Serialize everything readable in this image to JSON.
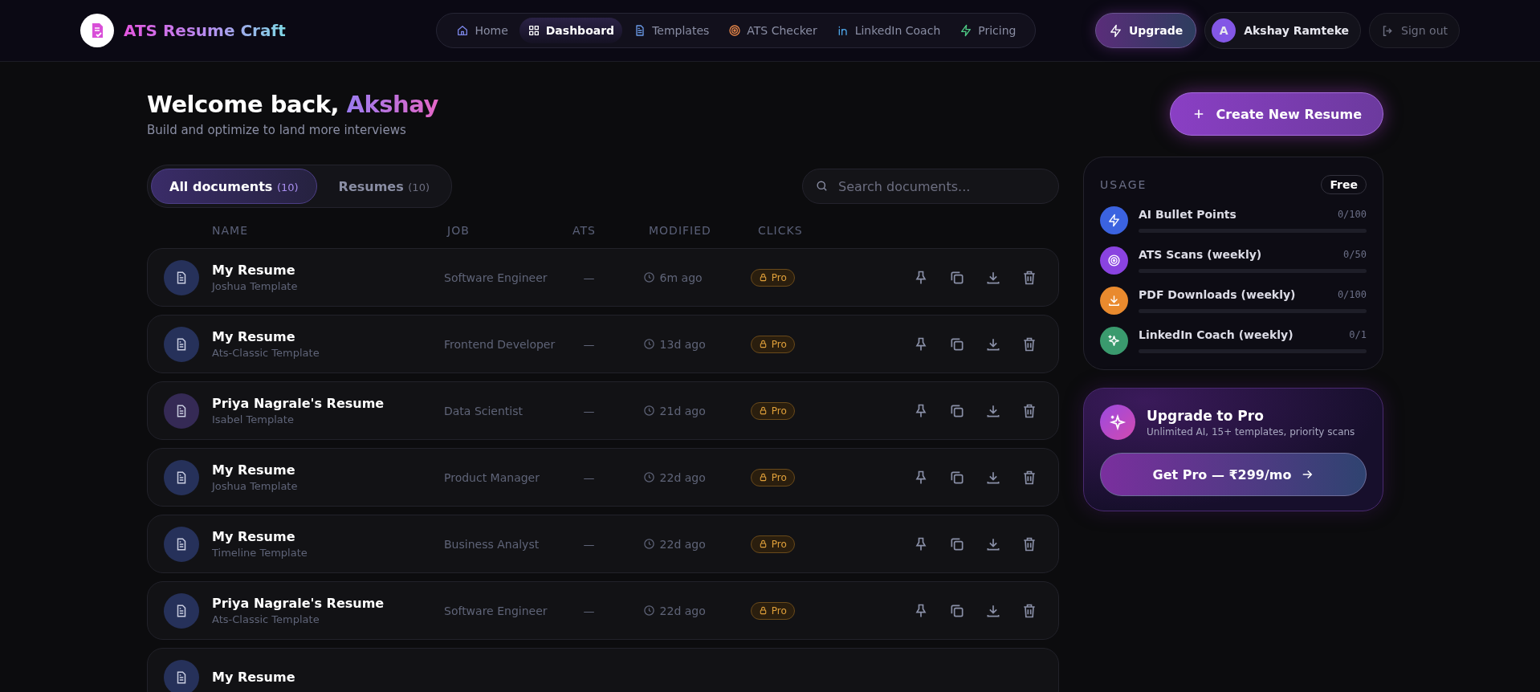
{
  "brand": {
    "name": "ATS Resume Craft"
  },
  "nav": [
    {
      "label": "Home",
      "kind": "home",
      "selected": false
    },
    {
      "label": "Dashboard",
      "kind": "grid",
      "selected": true
    },
    {
      "label": "Templates",
      "kind": "doc",
      "selected": false
    },
    {
      "label": "ATS Checker",
      "kind": "target",
      "selected": false
    },
    {
      "label": "LinkedIn Coach",
      "kind": "linkedin",
      "selected": false
    },
    {
      "label": "Pricing",
      "kind": "bolt",
      "selected": false
    }
  ],
  "header_actions": {
    "upgrade": "Upgrade",
    "user": {
      "initial": "A",
      "name": "Akshay Ramteke"
    },
    "signout": "Sign out"
  },
  "welcome": {
    "greeting": "Welcome back,",
    "name": "Akshay",
    "subtitle": "Build and optimize to land more interviews"
  },
  "create_button": "Create New Resume",
  "filters": [
    {
      "label": "All documents",
      "count": "(10)",
      "selected": true
    },
    {
      "label": "Resumes",
      "count": "(10)",
      "selected": false
    }
  ],
  "search": {
    "placeholder": "Search documents..."
  },
  "table": {
    "columns": [
      "NAME",
      "JOB",
      "ATS",
      "MODIFIED",
      "CLICKS"
    ],
    "rows": [
      {
        "name": "My Resume",
        "template": "Joshua Template",
        "job": "Software Engineer",
        "ats": "—",
        "modified": "6m ago",
        "clicks": "Pro",
        "color": "#26315a"
      },
      {
        "name": "My Resume",
        "template": "Ats-Classic Template",
        "job": "Frontend Developer",
        "ats": "—",
        "modified": "13d ago",
        "clicks": "Pro",
        "color": "#26315a"
      },
      {
        "name": "Priya Nagrale's Resume",
        "template": "Isabel Template",
        "job": "Data Scientist",
        "ats": "—",
        "modified": "21d ago",
        "clicks": "Pro",
        "color": "#352a55"
      },
      {
        "name": "My Resume",
        "template": "Joshua Template",
        "job": "Product Manager",
        "ats": "—",
        "modified": "22d ago",
        "clicks": "Pro",
        "color": "#26315a"
      },
      {
        "name": "My Resume",
        "template": "Timeline Template",
        "job": "Business Analyst",
        "ats": "—",
        "modified": "22d ago",
        "clicks": "Pro",
        "color": "#26315a"
      },
      {
        "name": "Priya Nagrale's Resume",
        "template": "Ats-Classic Template",
        "job": "Software Engineer",
        "ats": "—",
        "modified": "22d ago",
        "clicks": "Pro",
        "color": "#26315a"
      },
      {
        "name": "My Resume",
        "color": "#26315a"
      }
    ]
  },
  "usage": {
    "title": "USAGE",
    "plan": "Free",
    "items": [
      {
        "label": "AI Bullet Points",
        "reading": "0/100",
        "level": 0,
        "kind": "bolt",
        "color": "#3b63e0"
      },
      {
        "label": "ATS Scans (weekly)",
        "reading": "0/50",
        "level": 0,
        "kind": "target",
        "color": "#8a43e0"
      },
      {
        "label": "PDF Downloads (weekly)",
        "reading": "0/100",
        "level": 0,
        "kind": "download",
        "color": "#e98a2e"
      },
      {
        "label": "LinkedIn Coach (weekly)",
        "reading": "0/1",
        "level": 0,
        "kind": "sparkle",
        "color": "#3a9a6e"
      }
    ]
  },
  "promo": {
    "title": "Upgrade to Pro",
    "subtitle": "Unlimited AI, 15+ templates, priority scans",
    "button": "Get Pro — ₹299/mo"
  }
}
